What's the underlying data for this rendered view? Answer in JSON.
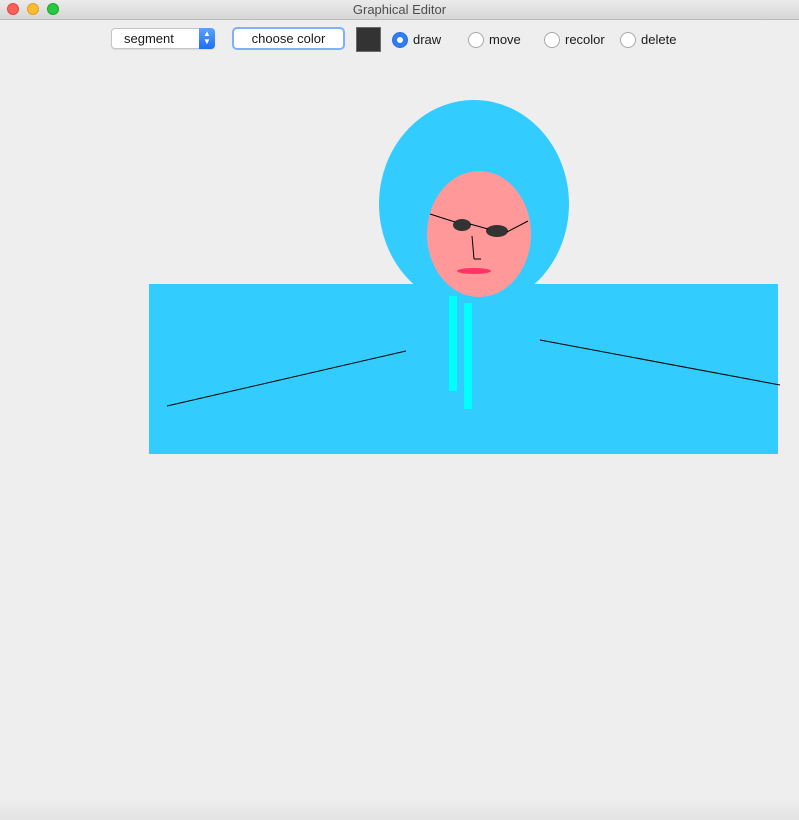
{
  "window": {
    "title": "Graphical Editor"
  },
  "toolbar": {
    "shape_select": {
      "selected": "segment"
    },
    "choose_color_label": "choose color",
    "current_color": "#333333",
    "modes": [
      {
        "label": "draw",
        "selected": true
      },
      {
        "label": "move",
        "selected": false
      },
      {
        "label": "recolor",
        "selected": false
      },
      {
        "label": "delete",
        "selected": false
      }
    ]
  },
  "colors": {
    "hood_blue": "#33ccff",
    "face_pink": "#ff9999",
    "cyan_strip": "#00ffff",
    "line_black": "#000000",
    "glasses": "#333333",
    "lips": "#ff3366"
  }
}
